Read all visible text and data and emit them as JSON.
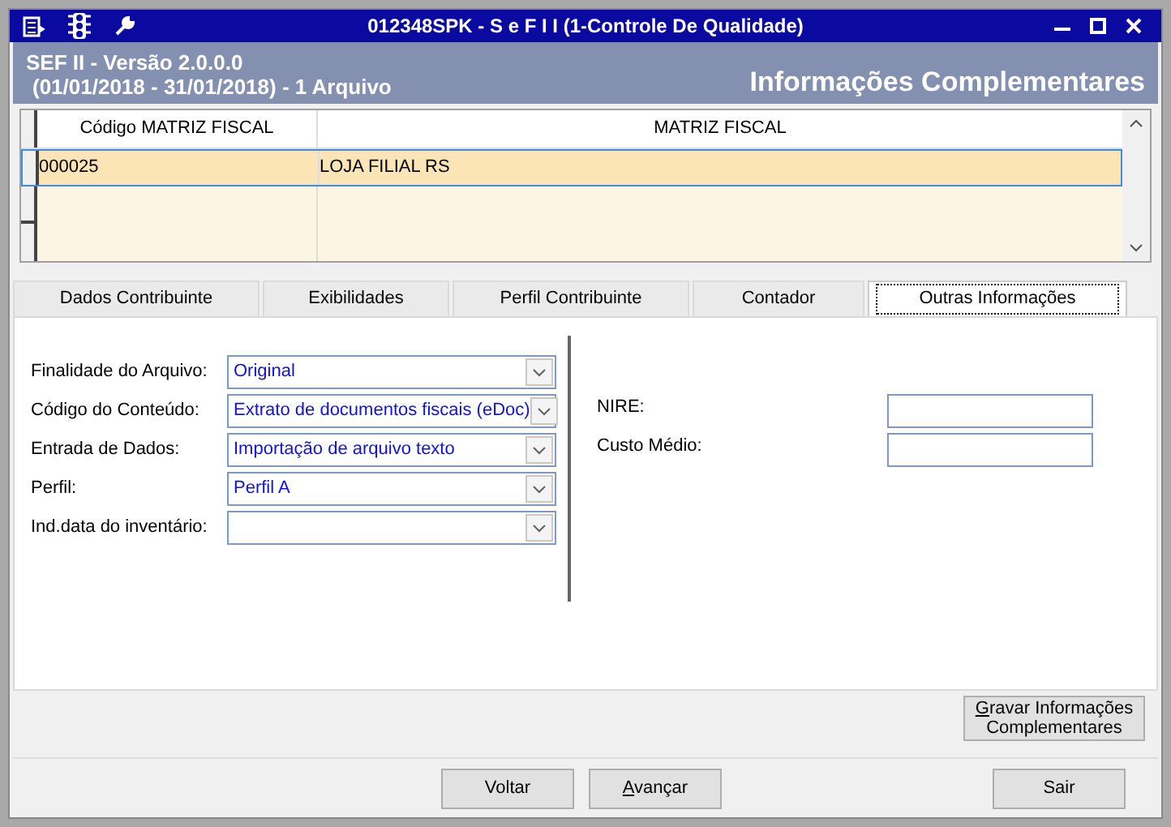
{
  "window": {
    "title": "012348SPK - S e F  I I (1-Controle De Qualidade)"
  },
  "header": {
    "version": "SEF II - Versão 2.0.0.0",
    "period": "(01/01/2018 - 31/01/2018) - 1 Arquivo",
    "page_title": "Informações Complementares"
  },
  "table": {
    "columns": [
      "Código MATRIZ FISCAL",
      "MATRIZ FISCAL"
    ],
    "rows": [
      {
        "cells": [
          "000025",
          "LOJA FILIAL RS"
        ],
        "selected": true
      }
    ]
  },
  "tabs": [
    {
      "label": "Dados Contribuinte",
      "selected": false
    },
    {
      "label": "Exibilidades",
      "selected": false
    },
    {
      "label": "Perfil Contribuinte",
      "selected": false
    },
    {
      "label": "Contador",
      "selected": false
    },
    {
      "label": "Outras Informações",
      "selected": true
    }
  ],
  "left_fields": [
    {
      "label": "Finalidade do Arquivo:",
      "value": "Original"
    },
    {
      "label": "Código do Conteúdo:",
      "value": "Extrato de documentos fiscais (eDoc)"
    },
    {
      "label": "Entrada de Dados:",
      "value": "Importação de arquivo texto"
    },
    {
      "label": "Perfil:",
      "value": "Perfil A"
    },
    {
      "label": "Ind.data do inventário:"
    }
  ],
  "right_fields": [
    {
      "label": "NIRE:"
    },
    {
      "label": "Custo Médio:"
    }
  ],
  "save_button": {
    "label": "Gravar Informações Complementares",
    "mnemonic_first": true
  },
  "buttons": [
    {
      "label": "Voltar",
      "mnemonic_first": false
    },
    {
      "label": "Avançar",
      "mnemonic_first": true
    },
    {
      "label": "Sair",
      "mnemonic_first": false
    }
  ]
}
